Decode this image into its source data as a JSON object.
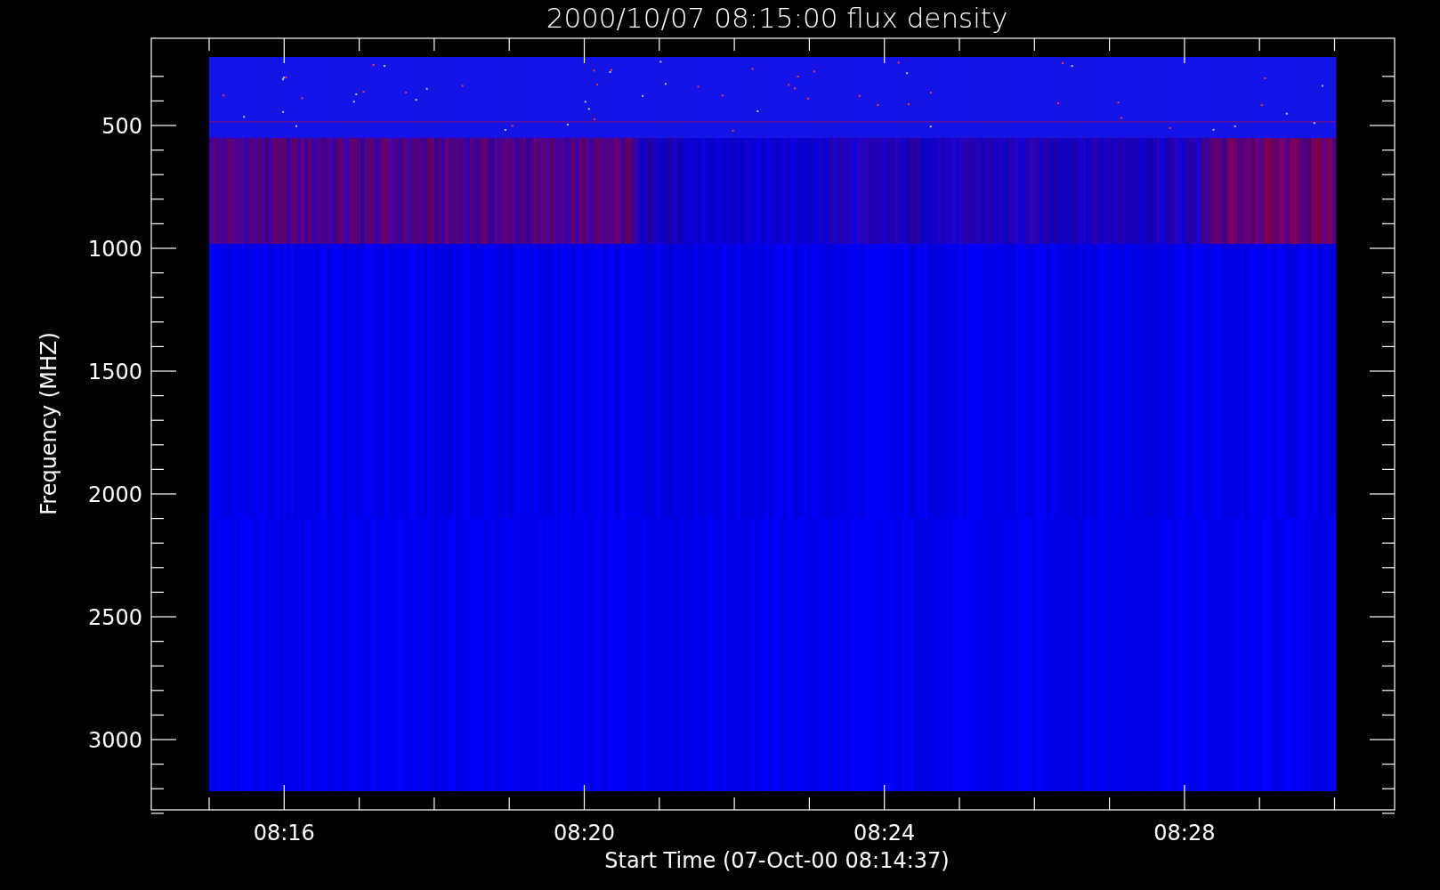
{
  "title": "2000/10/07 08:15:00 flux density",
  "y_axis": {
    "label": "Frequency (MHZ)",
    "tick_labels": [
      "500",
      "1000",
      "1500",
      "2000",
      "2500",
      "3000"
    ]
  },
  "x_axis": {
    "label": "Start Time (07-Oct-00 08:14:37)",
    "tick_labels": [
      "08:16",
      "08:20",
      "08:24",
      "08:28"
    ]
  }
}
